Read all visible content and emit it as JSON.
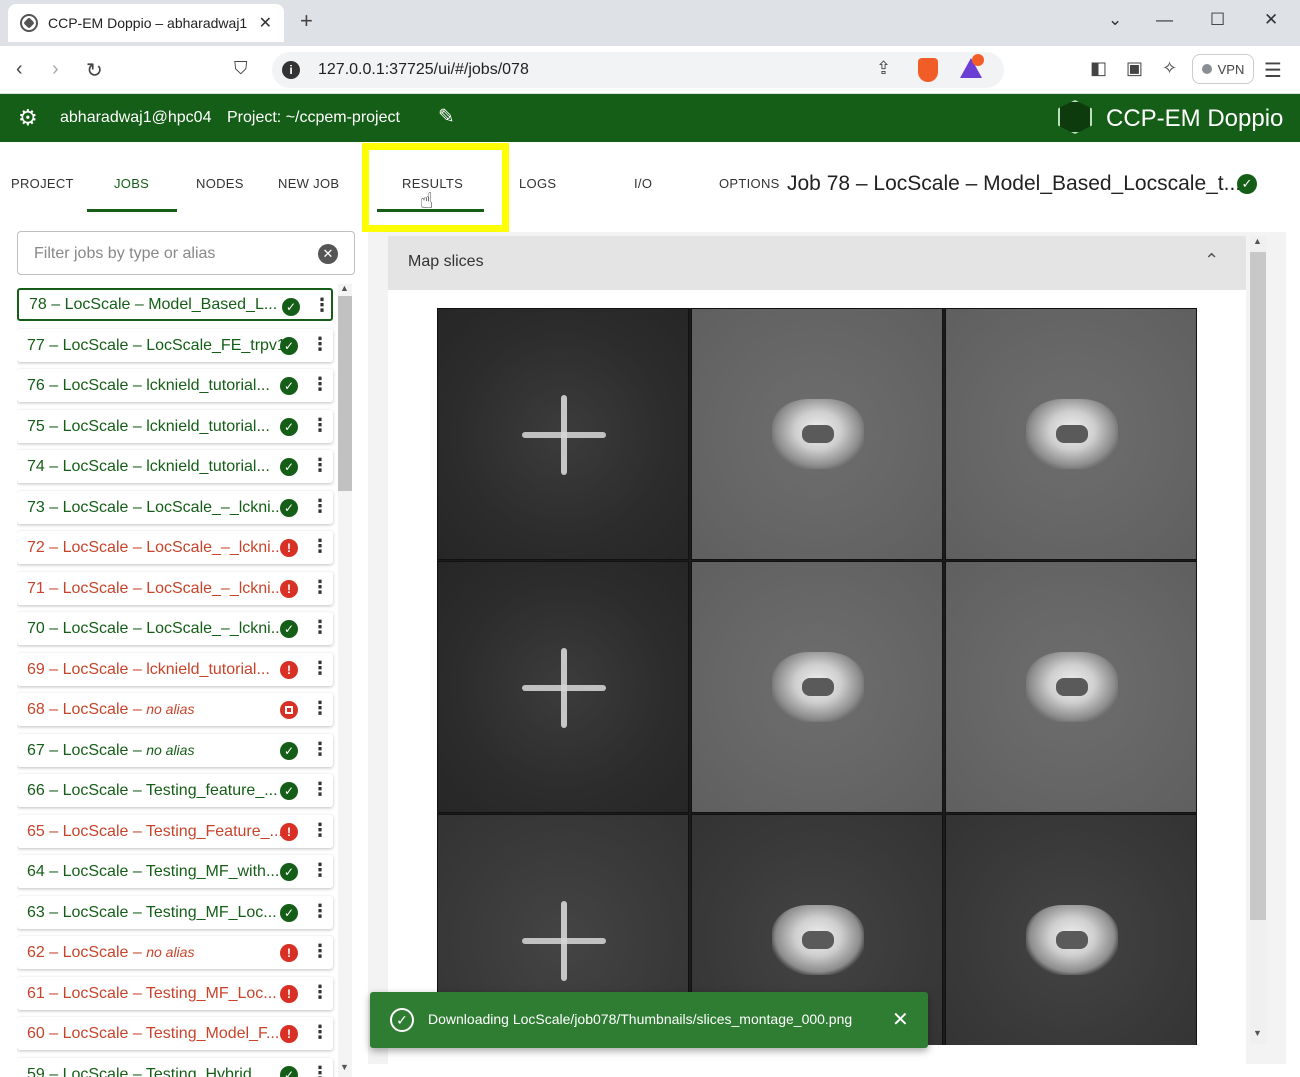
{
  "browser": {
    "tab_title": "CCP-EM Doppio – abharadwaj1",
    "tab_close": "✕",
    "new_tab": "+",
    "url": "127.0.0.1:37725/ui/#/jobs/078",
    "vpn_label": "VPN",
    "icons": [
      "back-icon",
      "forward-icon",
      "reload-icon",
      "bookmark-icon",
      "share-icon",
      "brave-shield-icon",
      "brave-rewards-icon",
      "sidebar-icon",
      "wallet-icon",
      "leo-icon",
      "menu-icon"
    ]
  },
  "app": {
    "user": "abharadwaj1@hpc04",
    "project": "Project:  ~/ccpem-project",
    "brand": "CCP-EM Doppio",
    "accent": "#155e17"
  },
  "nav": {
    "tabs": [
      "PROJECT",
      "JOBS",
      "NODES",
      "NEW JOB"
    ],
    "active": "JOBS"
  },
  "filter": {
    "placeholder": "Filter jobs by type or alias"
  },
  "jobs": [
    {
      "id": "78",
      "text": "78 – LocScale – Model_Based_L...",
      "status": "success",
      "selected": true
    },
    {
      "id": "77",
      "text": "77 – LocScale – LocScale_FE_trpv1",
      "status": "success"
    },
    {
      "id": "76",
      "text": "76 – LocScale – lcknield_tutorial...",
      "status": "success"
    },
    {
      "id": "75",
      "text": "75 – LocScale – lcknield_tutorial...",
      "status": "success"
    },
    {
      "id": "74",
      "text": "74 – LocScale – lcknield_tutorial...",
      "status": "success"
    },
    {
      "id": "73",
      "text": "73 – LocScale – LocScale_–_lckni...",
      "status": "success"
    },
    {
      "id": "72",
      "text": "72 – LocScale – LocScale_–_lckni...",
      "status": "error"
    },
    {
      "id": "71",
      "text": "71 – LocScale – LocScale_–_lckni...",
      "status": "error"
    },
    {
      "id": "70",
      "text": "70 – LocScale – LocScale_–_lckni...",
      "status": "success"
    },
    {
      "id": "69",
      "text": "69 – LocScale – lcknield_tutorial...",
      "status": "error"
    },
    {
      "id": "68",
      "text": "68 – LocScale – ",
      "alias": "no alias",
      "status": "stopped"
    },
    {
      "id": "67",
      "text": "67 – LocScale – ",
      "alias": "no alias",
      "status": "success"
    },
    {
      "id": "66",
      "text": "66 – LocScale – Testing_feature_...",
      "status": "success"
    },
    {
      "id": "65",
      "text": "65 – LocScale – Testing_Feature_...",
      "status": "error"
    },
    {
      "id": "64",
      "text": "64 – LocScale – Testing_MF_with...",
      "status": "success"
    },
    {
      "id": "63",
      "text": "63 – LocScale – Testing_MF_Loc...",
      "status": "success"
    },
    {
      "id": "62",
      "text": "62 – LocScale – ",
      "alias": "no alias",
      "status": "error"
    },
    {
      "id": "61",
      "text": "61 – LocScale – Testing_MF_Loc...",
      "status": "error"
    },
    {
      "id": "60",
      "text": "60 – LocScale – Testing_Model_F...",
      "status": "error"
    },
    {
      "id": "59",
      "text": "59 – LocScale – Testing_Hybrid",
      "status": "success"
    }
  ],
  "job_tabs": [
    "RESULTS",
    "LOGS",
    "I/O",
    "OPTIONS"
  ],
  "active_job_tab": "RESULTS",
  "job_title": "Job 78 – LocScale – Model_Based_Locscale_t...",
  "results": {
    "section_title": "Map slices"
  },
  "toast": {
    "message": "Downloading LocScale/job078/Thumbnails/slices_montage_000.png",
    "close": "✕"
  }
}
